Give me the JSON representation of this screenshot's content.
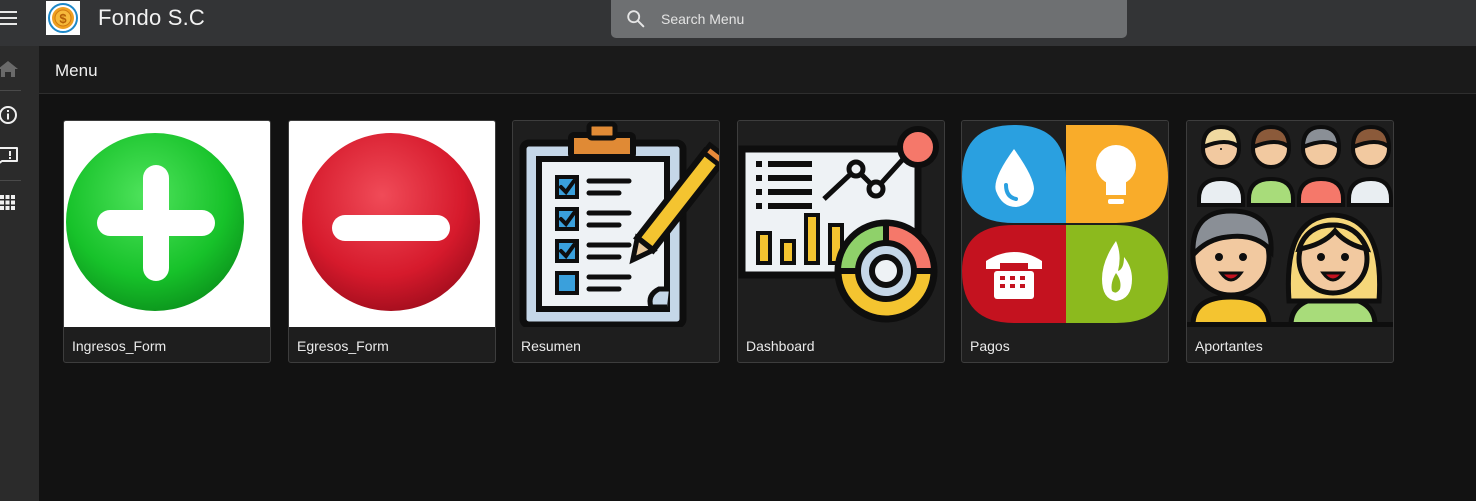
{
  "app": {
    "title": "Fondo S.C"
  },
  "search": {
    "placeholder": "Search Menu"
  },
  "page": {
    "title": "Menu"
  },
  "sidebar": {
    "items": [
      {
        "icon": "home-icon"
      },
      {
        "icon": "info-icon"
      },
      {
        "icon": "feedback-icon"
      },
      {
        "icon": "apps-grid-icon"
      }
    ]
  },
  "tiles": [
    {
      "label": "Ingresos_Form",
      "icon": "plus-circle-icon"
    },
    {
      "label": "Egresos_Form",
      "icon": "minus-circle-icon"
    },
    {
      "label": "Resumen",
      "icon": "clipboard-checklist-icon"
    },
    {
      "label": "Dashboard",
      "icon": "dashboard-chart-icon"
    },
    {
      "label": "Pagos",
      "icon": "utilities-icon"
    },
    {
      "label": "Aportantes",
      "icon": "people-group-icon"
    }
  ],
  "colors": {
    "topbar": "#333436",
    "background": "#121212",
    "search": "#6e7072",
    "sidebar": "#2b2b2b"
  }
}
